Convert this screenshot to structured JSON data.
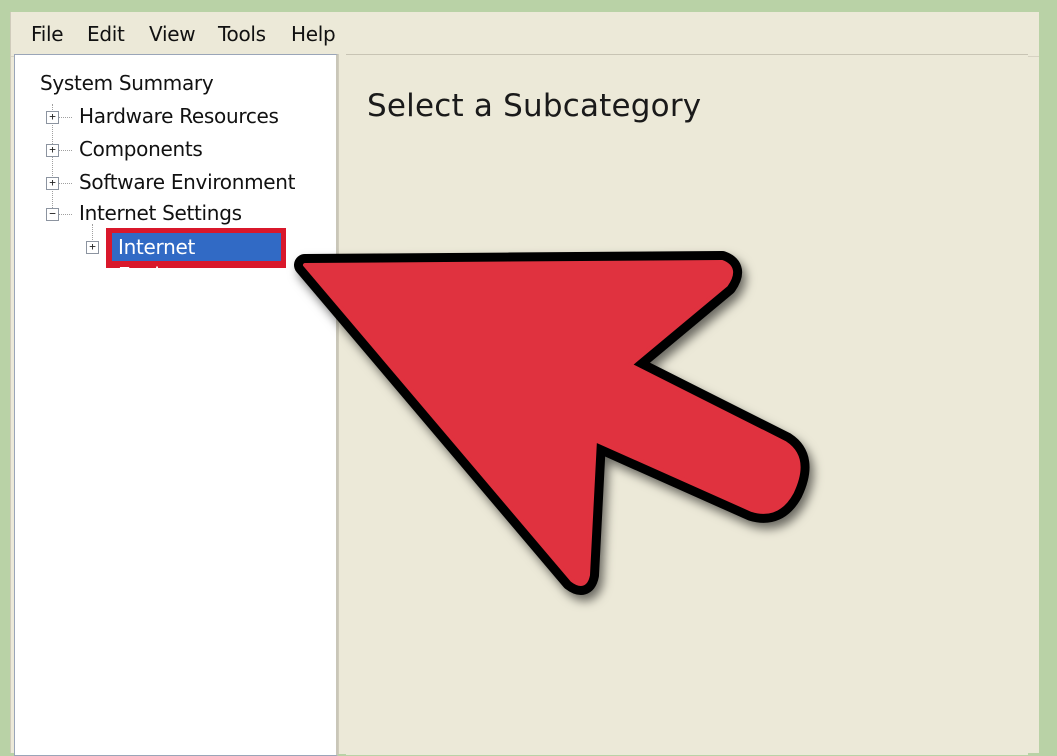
{
  "menu": {
    "items": [
      "File",
      "Edit",
      "View",
      "Tools",
      "Help"
    ]
  },
  "tree": {
    "root": "System Summary",
    "items": [
      {
        "label": "Hardware Resources",
        "expander": "+"
      },
      {
        "label": "Components",
        "expander": "+"
      },
      {
        "label": "Software Environment",
        "expander": "+"
      },
      {
        "label": "Internet Settings",
        "expander": "−"
      }
    ],
    "selected": {
      "label": "Internet Explorer",
      "expander": "+"
    }
  },
  "detail": {
    "title": "Select a Subcategory"
  },
  "annotation": {
    "arrow_color": "#e0323f",
    "highlight_color": "#d9182b",
    "selection_color": "#316ac5"
  }
}
